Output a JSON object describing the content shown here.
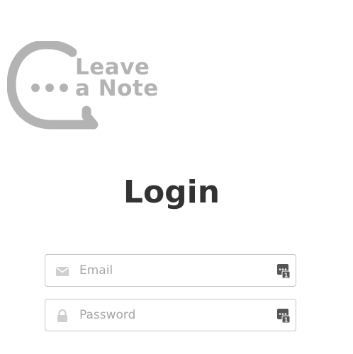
{
  "logo": {
    "line1": "Leave",
    "line2": "a Note",
    "color": "#b3b3b3"
  },
  "page": {
    "title": "Login"
  },
  "form": {
    "email": {
      "placeholder": "Email",
      "value": "",
      "icon": "envelope-icon"
    },
    "password": {
      "placeholder": "Password",
      "value": "",
      "icon": "lock-icon"
    },
    "password_manager_icon": "password-manager-icon"
  },
  "colors": {
    "title": "#333333",
    "input_border": "#c4c4c4",
    "placeholder": "#a6a6a6",
    "icon": "#c8c8c8"
  }
}
